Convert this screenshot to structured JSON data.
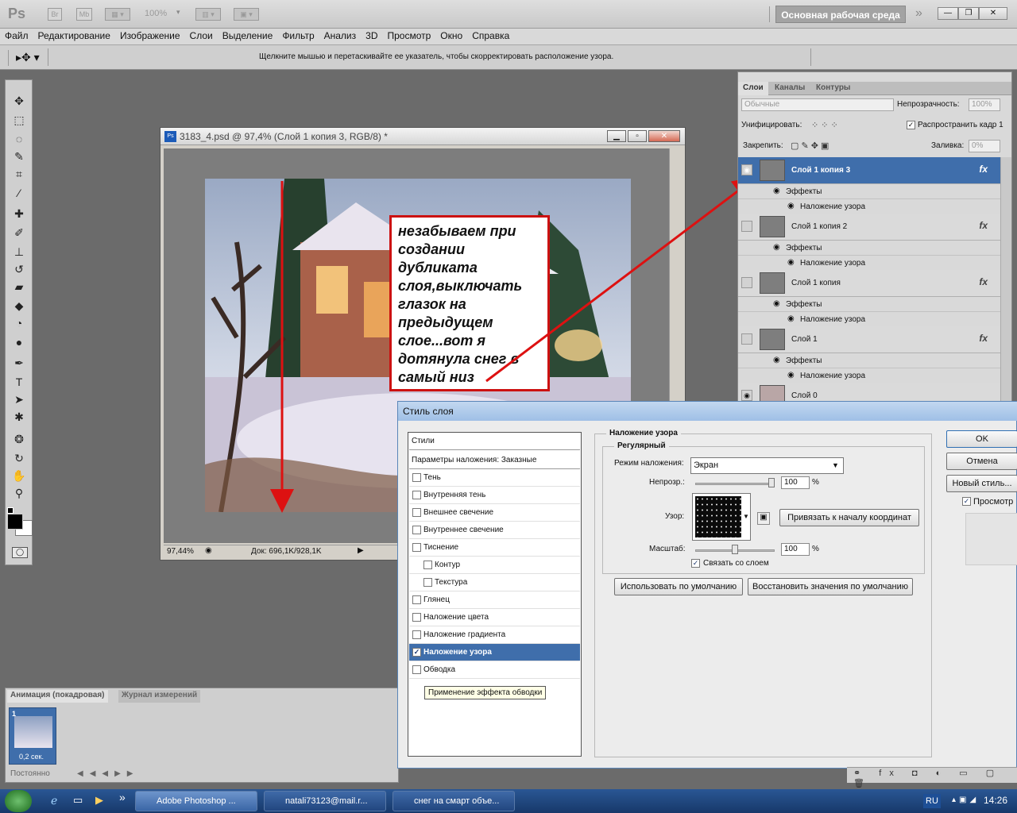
{
  "appbar": {
    "logo": "Ps",
    "br": "Br",
    "mb": "Mb",
    "zoom": "100%",
    "workspace": "Основная рабочая среда"
  },
  "menu": [
    "Файл",
    "Редактирование",
    "Изображение",
    "Слои",
    "Выделение",
    "Фильтр",
    "Анализ",
    "3D",
    "Просмотр",
    "Окно",
    "Справка"
  ],
  "options": {
    "hint": "Щелкните мышью и перетаскивайте ее указатель, чтобы скорректировать расположение узора."
  },
  "document": {
    "title": "3183_4.psd @ 97,4% (Слой 1 копия 3, RGB/8) *",
    "zoom": "97,44%",
    "doc_info": "Док: 696,1K/928,1K",
    "note": "незабываем при создании дубликата слоя,выключать глазок на предыдущем слое...вот я дотянула снег в самый низ"
  },
  "layers_panel": {
    "tabs": [
      "Слои",
      "Каналы",
      "Контуры"
    ],
    "blend": "Обычные",
    "opacity_label": "Непрозрачность:",
    "opacity": "100%",
    "unify_label": "Унифицировать:",
    "propagate": "Распространить кадр 1",
    "lock_label": "Закрепить:",
    "fill_label": "Заливка:",
    "fill": "0%",
    "layers": [
      {
        "name": "Слой 1 копия 3",
        "effects": "Эффекты",
        "effect": "Наложение узора",
        "fx": "fx"
      },
      {
        "name": "Слой 1 копия 2",
        "effects": "Эффекты",
        "effect": "Наложение узора",
        "fx": "fx"
      },
      {
        "name": "Слой 1 копия",
        "effects": "Эффекты",
        "effect": "Наложение узора",
        "fx": "fx"
      },
      {
        "name": "Слой 1",
        "effects": "Эффекты",
        "effect": "Наложение узора",
        "fx": "fx"
      },
      {
        "name": "Слой 0"
      }
    ]
  },
  "dialog": {
    "title": "Стиль слоя",
    "styles_header": "Стили",
    "blend_params": "Параметры наложения: Заказные",
    "items": [
      {
        "label": "Тень",
        "checked": false
      },
      {
        "label": "Внутренняя тень",
        "checked": false
      },
      {
        "label": "Внешнее свечение",
        "checked": false
      },
      {
        "label": "Внутреннее свечение",
        "checked": false
      },
      {
        "label": "Тиснение",
        "checked": false
      },
      {
        "label": "Контур",
        "checked": false,
        "indent": true
      },
      {
        "label": "Текстура",
        "checked": false,
        "indent": true
      },
      {
        "label": "Глянец",
        "checked": false
      },
      {
        "label": "Наложение цвета",
        "checked": false
      },
      {
        "label": "Наложение градиента",
        "checked": false
      },
      {
        "label": "Наложение узора",
        "checked": true,
        "selected": true
      },
      {
        "label": "Обводка",
        "checked": false
      }
    ],
    "tooltip": "Применение эффекта обводки",
    "section_title": "Наложение узора",
    "subsection": "Регулярный",
    "blend_mode_label": "Режим наложения:",
    "blend_mode": "Экран",
    "opacity_label": "Непрозр.:",
    "opacity": "100",
    "opacity_unit": "%",
    "opacity_level": 100,
    "pattern_label": "Узор:",
    "snap_button": "Привязать к началу координат",
    "scale_label": "Масштаб:",
    "scale": "100",
    "scale_unit": "%",
    "scale_level": 50,
    "link_label": "Связать со слоем",
    "link_checked": true,
    "default_button": "Использовать по умолчанию",
    "restore_button": "Восстановить значения по умолчанию",
    "ok": "OK",
    "cancel": "Отмена",
    "new_style": "Новый стиль...",
    "preview": "Просмотр"
  },
  "animation": {
    "tabs": [
      "Анимация (покадровая)",
      "Журнал измерений"
    ],
    "frame_number": "1",
    "frame_delay": "0,2 сек.",
    "loop": "Постоянно"
  },
  "taskbar": {
    "items": [
      "Adobe Photoshop ...",
      "natali73123@mail.r...",
      "снег на смарт объе..."
    ],
    "lang": "RU",
    "time": "14:26"
  }
}
